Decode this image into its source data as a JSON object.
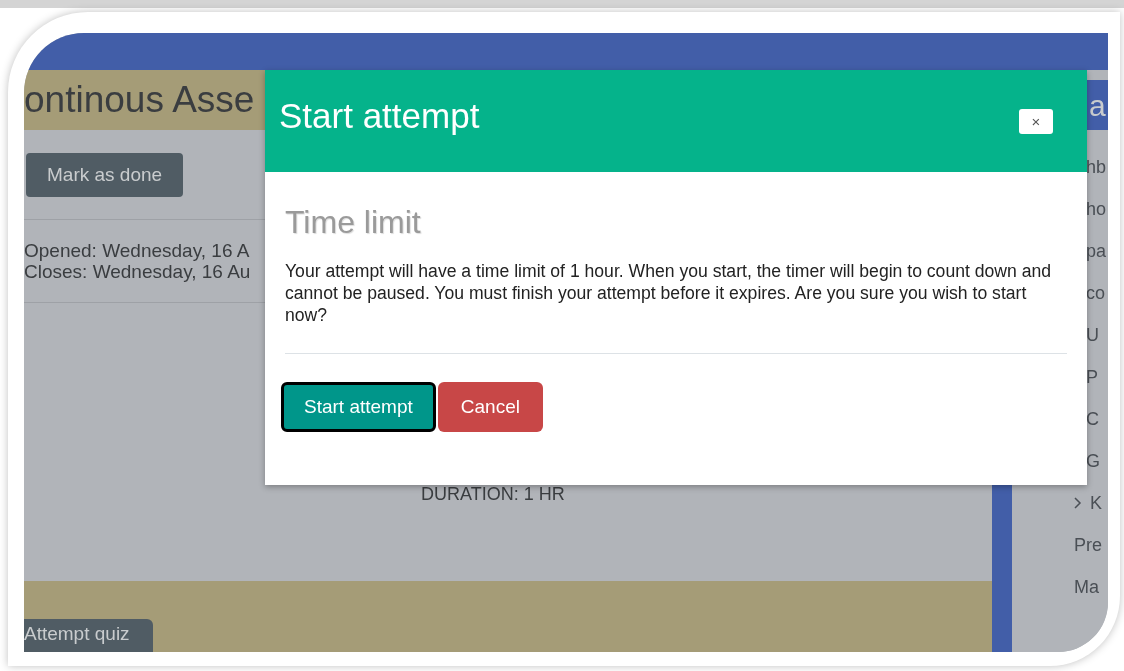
{
  "page": {
    "title": "ontinous Asse",
    "mark_done_button": "Mark as done",
    "opened": "Opened: Wednesday, 16 A",
    "closes": "Closes: Wednesday, 16 Au",
    "duration": "DURATION: 1 HR",
    "attempt_button": "Attempt quiz"
  },
  "sidebar": {
    "header": "a",
    "items": [
      {
        "label": "hb",
        "chevron": false
      },
      {
        "label": "ho",
        "chevron": false
      },
      {
        "label": "pa",
        "chevron": false
      },
      {
        "label": "co",
        "chevron": false
      },
      {
        "label": "U",
        "chevron": false
      },
      {
        "label": "P",
        "chevron": false
      },
      {
        "label": "C",
        "chevron": false
      },
      {
        "label": "G",
        "chevron": false
      },
      {
        "label": "K",
        "chevron": true
      },
      {
        "label": "Pre",
        "chevron": false
      },
      {
        "label": "Ma",
        "chevron": false
      }
    ]
  },
  "modal": {
    "title": "Start attempt",
    "close": "×",
    "heading": "Time limit",
    "message": "Your attempt will have a time limit of 1 hour. When you start, the timer will begin to count down and cannot be paused. You must finish your attempt before it expires. Are you sure you wish to start now?",
    "buttons": [
      {
        "label": "Start attempt",
        "kind": "primary",
        "focused": true
      },
      {
        "label": "Cancel",
        "kind": "danger",
        "focused": false
      }
    ]
  }
}
